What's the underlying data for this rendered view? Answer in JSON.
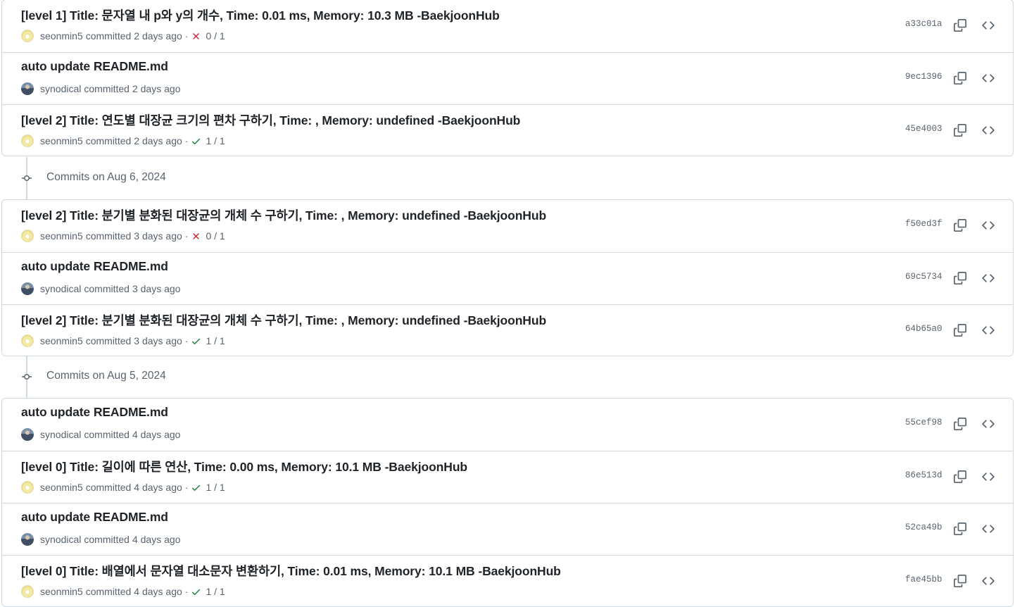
{
  "groups": [
    {
      "commits": [
        {
          "title": "[level 1] Title: 문자열 내 p와 y의 개수, Time: 0.01 ms, Memory: 10.3 MB -BaekjoonHub",
          "author": "seonmin5",
          "committed": "committed",
          "when": "2 days ago",
          "status": "fail",
          "checks": "0 / 1",
          "sha": "a33c01a",
          "avatar": "yellow"
        },
        {
          "title": "auto update README.md",
          "author": "synodical",
          "committed": "committed",
          "when": "2 days ago",
          "status": "none",
          "checks": "",
          "sha": "9ec1396",
          "avatar": "photo"
        },
        {
          "title": "[level 2] Title: 연도별 대장균 크기의 편차 구하기, Time: , Memory: undefined -BaekjoonHub",
          "author": "seonmin5",
          "committed": "committed",
          "when": "2 days ago",
          "status": "ok",
          "checks": "1 / 1",
          "sha": "45e4003",
          "avatar": "yellow"
        }
      ]
    },
    {
      "date_label": "Commits on Aug 6, 2024",
      "commits": [
        {
          "title": "[level 2] Title: 분기별 분화된 대장균의 개체 수 구하기, Time: , Memory: undefined -BaekjoonHub",
          "author": "seonmin5",
          "committed": "committed",
          "when": "3 days ago",
          "status": "fail",
          "checks": "0 / 1",
          "sha": "f50ed3f",
          "avatar": "yellow"
        },
        {
          "title": "auto update README.md",
          "author": "synodical",
          "committed": "committed",
          "when": "3 days ago",
          "status": "none",
          "checks": "",
          "sha": "69c5734",
          "avatar": "photo"
        },
        {
          "title": "[level 2] Title: 분기별 분화된 대장균의 개체 수 구하기, Time: , Memory: undefined -BaekjoonHub",
          "author": "seonmin5",
          "committed": "committed",
          "when": "3 days ago",
          "status": "ok",
          "checks": "1 / 1",
          "sha": "64b65a0",
          "avatar": "yellow"
        }
      ]
    },
    {
      "date_label": "Commits on Aug 5, 2024",
      "commits": [
        {
          "title": "auto update README.md",
          "author": "synodical",
          "committed": "committed",
          "when": "4 days ago",
          "status": "none",
          "checks": "",
          "sha": "55cef98",
          "avatar": "photo"
        },
        {
          "title": "[level 0] Title: 길이에 따른 연산, Time: 0.00 ms, Memory: 10.1 MB -BaekjoonHub",
          "author": "seonmin5",
          "committed": "committed",
          "when": "4 days ago",
          "status": "ok",
          "checks": "1 / 1",
          "sha": "86e513d",
          "avatar": "yellow"
        },
        {
          "title": "auto update README.md",
          "author": "synodical",
          "committed": "committed",
          "when": "4 days ago",
          "status": "none",
          "checks": "",
          "sha": "52ca49b",
          "avatar": "photo"
        },
        {
          "title": "[level 0] Title: 배열에서 문자열 대소문자 변환하기, Time: 0.01 ms, Memory: 10.1 MB -BaekjoonHub",
          "author": "seonmin5",
          "committed": "committed",
          "when": "4 days ago",
          "status": "ok",
          "checks": "1 / 1",
          "sha": "fae45bb",
          "avatar": "yellow"
        }
      ]
    }
  ],
  "icons": {
    "copy": "copy-icon",
    "browse": "code-icon",
    "fail": "x-icon",
    "ok": "check-icon",
    "timeline": "commit-icon"
  },
  "colors": {
    "fail": "#cf222e",
    "ok": "#1a7f37",
    "muted": "#59636e",
    "border": "#d1d9e0"
  }
}
